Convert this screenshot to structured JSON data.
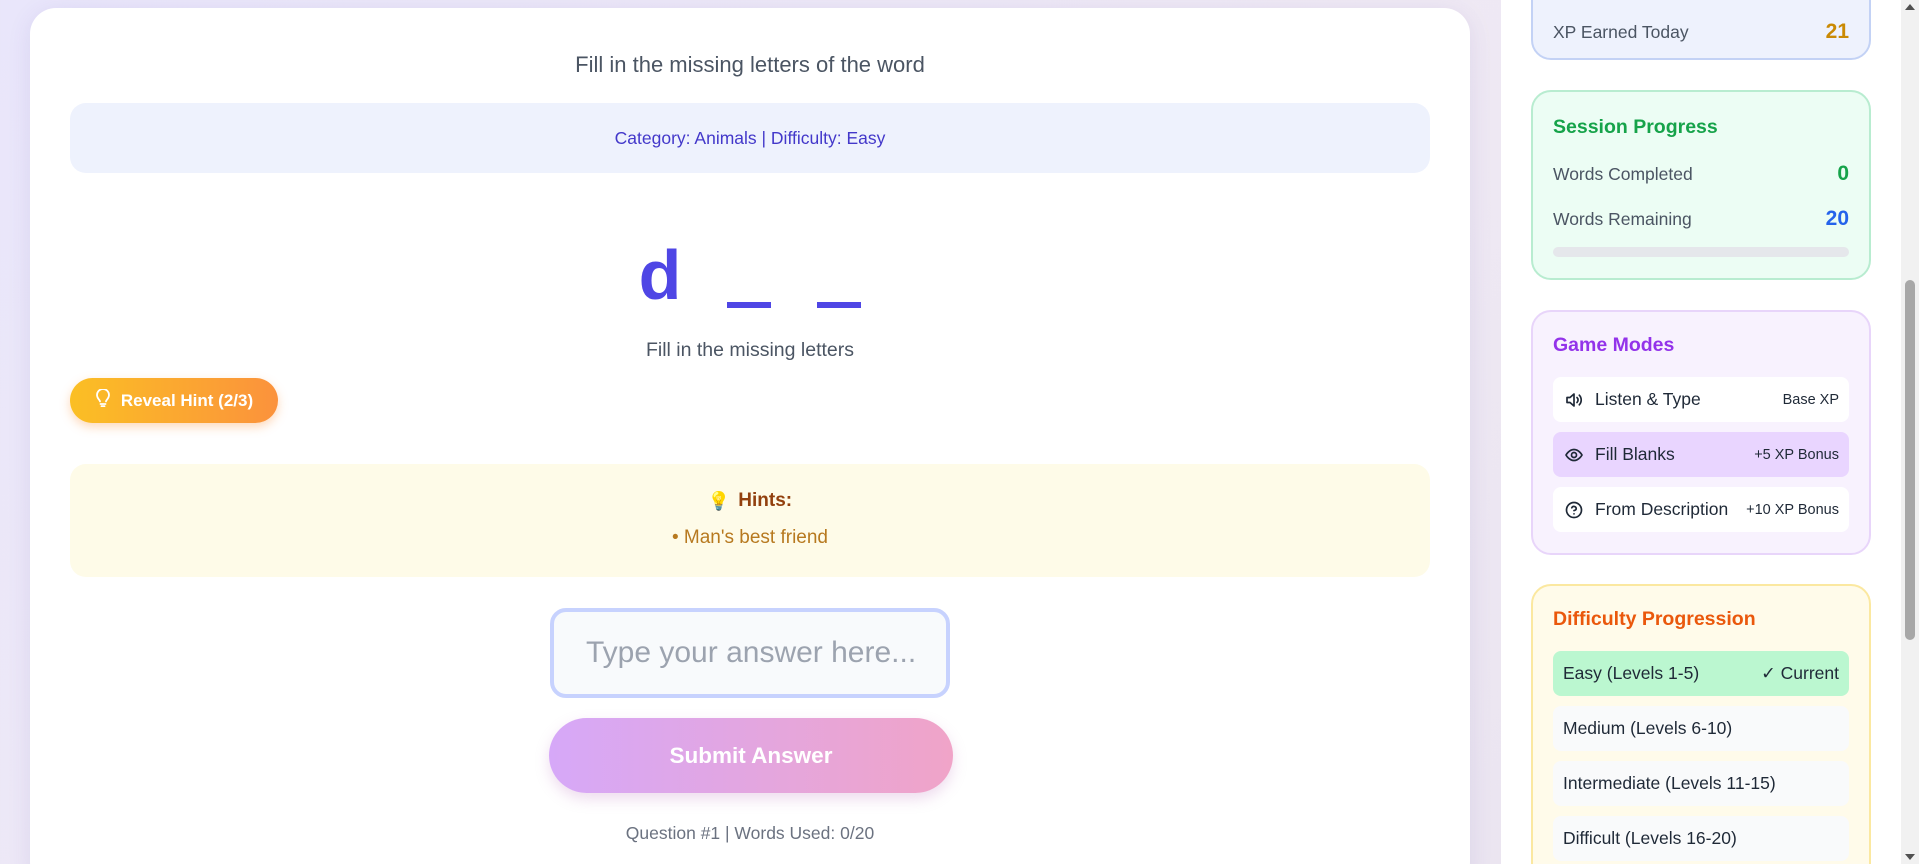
{
  "game": {
    "instruction": "Fill in the missing letters of the word",
    "category_line": "Category: Animals | Difficulty: Easy",
    "word_display": [
      "d",
      "_",
      "_"
    ],
    "word_caption": "Fill in the missing letters",
    "hint_button_label": "Reveal Hint (2/3)",
    "hints_title": "Hints:",
    "hints": [
      "• Man's best friend"
    ],
    "answer_placeholder": "Type your answer here...",
    "answer_value": "",
    "submit_label": "Submit Answer",
    "question_info": "Question #1 | Words Used: 0/20"
  },
  "sidebar": {
    "xp_panel": {
      "label": "XP Earned Today",
      "value": "21"
    },
    "session_progress": {
      "title": "Session Progress",
      "words_completed_label": "Words Completed",
      "words_completed_value": "0",
      "words_remaining_label": "Words Remaining",
      "words_remaining_value": "20",
      "progress_fraction": 0
    },
    "game_modes": {
      "title": "Game Modes",
      "items": [
        {
          "label": "Listen & Type",
          "badge": "Base XP",
          "icon": "speaker-icon",
          "active": false
        },
        {
          "label": "Fill Blanks",
          "badge": "+5 XP Bonus",
          "icon": "eye-icon",
          "active": true
        },
        {
          "label": "From Description",
          "badge": "+10 XP Bonus",
          "icon": "question-circle-icon",
          "active": false
        }
      ]
    },
    "difficulty_progression": {
      "title": "Difficulty Progression",
      "items": [
        {
          "label": "Easy (Levels 1-5)",
          "status": "✓ Current"
        },
        {
          "label": "Medium (Levels 6-10)",
          "status": ""
        },
        {
          "label": "Intermediate (Levels 11-15)",
          "status": ""
        },
        {
          "label": "Difficult (Levels 16-20)",
          "status": ""
        }
      ]
    }
  },
  "colors": {
    "primary": "#4f46e5",
    "xp_value": "#ca8a04",
    "session_title": "#16a34a",
    "completed_value": "#16a34a",
    "remaining_value": "#2563eb",
    "modes_title": "#9333ea",
    "difficulty_title": "#ea580c"
  }
}
